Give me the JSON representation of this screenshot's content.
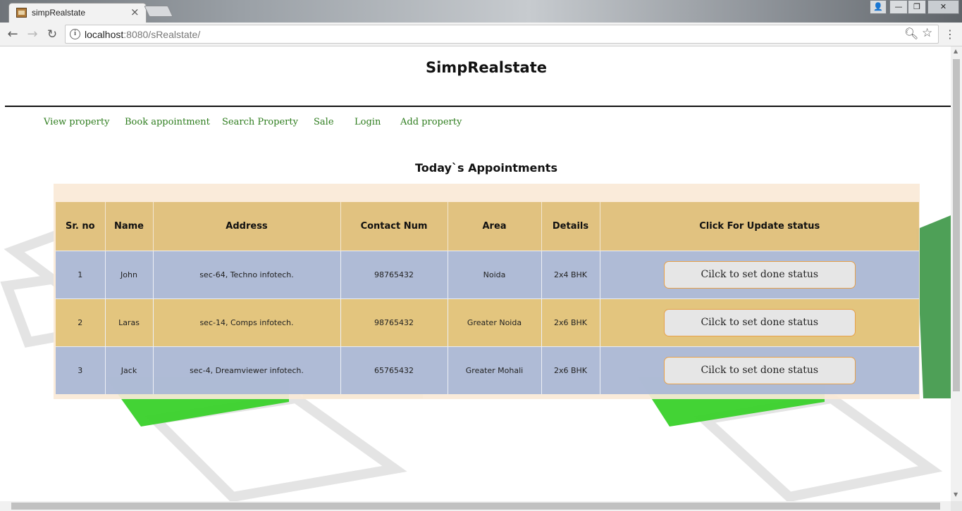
{
  "browser": {
    "tab_title": "simpRealstate",
    "tab_close": "×",
    "url_host": "localhost",
    "url_rest": ":8080/sRealstate/",
    "icons": [
      "back-arrow-icon",
      "forward-arrow-icon",
      "reload-icon",
      "info-icon",
      "zoom-icon",
      "star-icon",
      "menu-icon"
    ]
  },
  "site": {
    "title": "SimpRealstate",
    "nav": [
      "View property",
      "Book appointment",
      "Search Property",
      "Sale",
      "Login",
      "Add property"
    ],
    "nav_color": "#2e7d1e"
  },
  "appointments": {
    "title": "Today`s Appointments",
    "headers": [
      "Sr. no",
      "Name",
      "Address",
      "Contact Num",
      "Area",
      "Details",
      "Click For Update status"
    ],
    "rows": [
      {
        "sr": "1",
        "name": "John",
        "address": "sec-64, Techno infotech.",
        "contact": "98765432",
        "area": "Noida",
        "details": "2x4 BHK",
        "action": "Cilck to set done status"
      },
      {
        "sr": "2",
        "name": "Laras",
        "address": "sec-14, Comps infotech.",
        "contact": "98765432",
        "area": "Greater Noida",
        "details": "2x6 BHK",
        "action": "Cilck to set done status"
      },
      {
        "sr": "3",
        "name": "Jack",
        "address": "sec-4, Dreamviewer infotech.",
        "contact": "65765432",
        "area": "Greater Mohali",
        "details": "2x6 BHK",
        "action": "Cilck to set done status"
      }
    ],
    "colors": {
      "header": "#debe78",
      "row_blue": "#a8b6d6",
      "row_gold": "#e1c176",
      "panel": "#faead7"
    }
  }
}
